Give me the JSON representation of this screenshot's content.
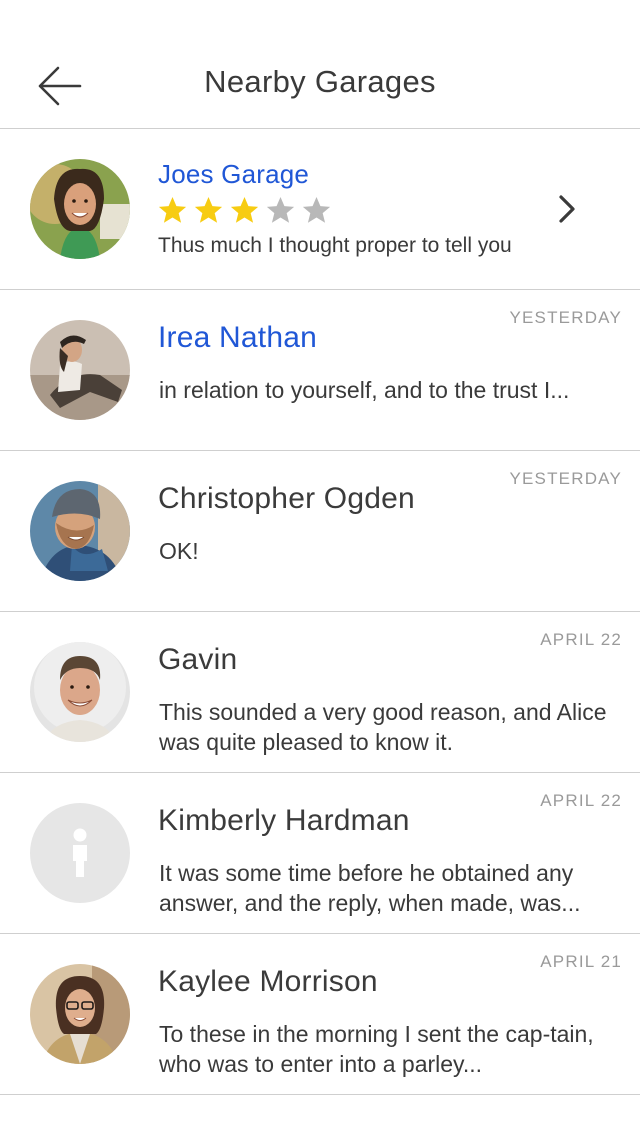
{
  "header": {
    "title": "Nearby Garages",
    "back_icon": "arrow-left-icon"
  },
  "colors": {
    "accent_blue": "#2057d6",
    "star_filled": "#f7cc12",
    "star_empty": "#b8b8b8",
    "divider": "#cfcfcf",
    "date_gray": "#9a9a9a"
  },
  "garage": {
    "name": "Joes Garage",
    "rating": 3,
    "rating_max": 5,
    "description": "Thus much I thought proper to tell you",
    "chevron_icon": "chevron-right-icon"
  },
  "messages": [
    {
      "name": "Irea Nathan",
      "date": "YESTERDAY",
      "preview": " in relation to yourself, and to the trust I..."
    },
    {
      "name": "Christopher Ogden",
      "date": "YESTERDAY",
      "preview": "OK!"
    },
    {
      "name": "Gavin",
      "date": "APRIL 22",
      "preview": "This sounded a very good reason, and Alice was quite pleased to know it."
    },
    {
      "name": "Kimberly Hardman",
      "date": "APRIL 22",
      "preview": "It was some time before he obtained any answer, and the reply, when made, was..."
    },
    {
      "name": "Kaylee Morrison",
      "date": "APRIL 21",
      "preview": "To these in the morning I sent the cap-tain, who was to enter into a parley..."
    }
  ]
}
